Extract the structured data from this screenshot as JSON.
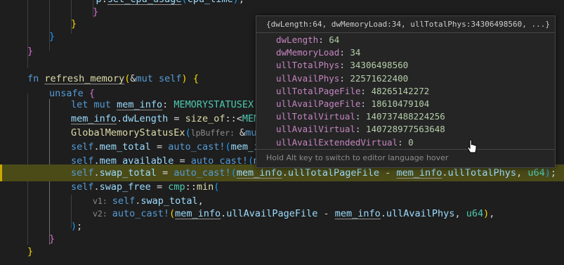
{
  "editor": {
    "lines": [
      {
        "id": "L0",
        "tokens": [
          [
            "p",
            "            "
          ],
          [
            "id",
            "p"
          ],
          [
            "p",
            "."
          ],
          [
            "id",
            "set_cpu_usage"
          ],
          [
            "br3",
            "("
          ],
          [
            "id",
            "cpu_time"
          ],
          [
            "br3",
            ")"
          ],
          [
            "p",
            ";"
          ]
        ]
      },
      {
        "id": "L1",
        "tokens": [
          [
            "br2",
            "}"
          ]
        ]
      },
      {
        "id": "L2",
        "tokens": [
          [
            "br1",
            "}"
          ]
        ]
      },
      {
        "id": "L3",
        "tokens": [
          [
            "br3",
            "}"
          ]
        ]
      },
      {
        "id": "L4",
        "tokens": [
          [
            "br2",
            "}"
          ]
        ]
      },
      {
        "id": "L5",
        "tokens": []
      },
      {
        "id": "L6",
        "tokens": [
          [
            "kw",
            "fn"
          ],
          [
            "p",
            " "
          ],
          [
            "fnc",
            "refresh_memory"
          ],
          [
            "br1",
            "("
          ],
          [
            "p",
            "&"
          ],
          [
            "kw",
            "mut"
          ],
          [
            "p",
            " "
          ],
          [
            "self",
            "self"
          ],
          [
            "br1",
            ")"
          ],
          [
            "p",
            " "
          ],
          [
            "br1",
            "{"
          ]
        ]
      },
      {
        "id": "L7",
        "tokens": [
          [
            "kw",
            "unsafe"
          ],
          [
            "p",
            " "
          ],
          [
            "br2",
            "{"
          ]
        ]
      },
      {
        "id": "L8",
        "tokens": [
          [
            "kw",
            "let"
          ],
          [
            "p",
            " "
          ],
          [
            "kw",
            "mut"
          ],
          [
            "p",
            " "
          ],
          [
            "id",
            "mem_info"
          ],
          [
            "p",
            ": "
          ],
          [
            "ty",
            "MEMORYSTATUSEX"
          ],
          [
            "p",
            " ="
          ]
        ]
      },
      {
        "id": "L9",
        "tokens": [
          [
            "id",
            "mem_info"
          ],
          [
            "p",
            "."
          ],
          [
            "id",
            "dwLength"
          ],
          [
            "p",
            " = "
          ],
          [
            "fnc",
            "size_of"
          ],
          [
            "p",
            "::<"
          ],
          [
            "ty",
            "MEMORY"
          ]
        ]
      },
      {
        "id": "L10",
        "tokens": [
          [
            "fnc",
            "GlobalMemoryStatusEx"
          ],
          [
            "br3",
            "("
          ],
          [
            "hint",
            "lpBuffer: "
          ],
          [
            "p",
            "&"
          ],
          [
            "kw",
            "mut"
          ]
        ]
      },
      {
        "id": "L11",
        "tokens": [
          [
            "self",
            "self"
          ],
          [
            "p",
            "."
          ],
          [
            "id",
            "mem_total"
          ],
          [
            "p",
            " = "
          ],
          [
            "mac",
            "auto_cast!"
          ],
          [
            "br3",
            "("
          ],
          [
            "id",
            "mem_in"
          ]
        ]
      },
      {
        "id": "L12",
        "tokens": [
          [
            "self",
            "self"
          ],
          [
            "p",
            "."
          ],
          [
            "id",
            "mem_available"
          ],
          [
            "p",
            " = "
          ],
          [
            "mac",
            "auto_cast!"
          ],
          [
            "br3",
            "("
          ],
          [
            "id",
            "me"
          ]
        ]
      },
      {
        "id": "L13",
        "tokens": [
          [
            "self",
            "self"
          ],
          [
            "p",
            "."
          ],
          [
            "id",
            "swap_total"
          ],
          [
            "p",
            " = "
          ],
          [
            "mac",
            "auto_cast!"
          ],
          [
            "br3",
            "("
          ],
          [
            "id",
            "mem_info"
          ],
          [
            "p",
            "."
          ],
          [
            "id",
            "ullTotalPageFile"
          ],
          [
            "p",
            " - "
          ],
          [
            "id",
            "mem_info"
          ],
          [
            "p",
            "."
          ],
          [
            "id",
            "ullTotalPhys"
          ],
          [
            "p",
            ", "
          ],
          [
            "ty",
            "u64"
          ],
          [
            "br3",
            ")"
          ],
          [
            "p",
            ";"
          ]
        ]
      },
      {
        "id": "L14",
        "tokens": [
          [
            "self",
            "self"
          ],
          [
            "p",
            "."
          ],
          [
            "id",
            "swap_free"
          ],
          [
            "p",
            " = "
          ],
          [
            "ty",
            "cmp"
          ],
          [
            "p",
            "::"
          ],
          [
            "fnc",
            "min"
          ],
          [
            "br3",
            "("
          ]
        ]
      },
      {
        "id": "L15",
        "tokens": [
          [
            "hint",
            "v1: "
          ],
          [
            "self",
            "self"
          ],
          [
            "p",
            "."
          ],
          [
            "id",
            "swap_total"
          ],
          [
            "p",
            ","
          ]
        ]
      },
      {
        "id": "L16",
        "tokens": [
          [
            "hint",
            "v2: "
          ],
          [
            "mac",
            "auto_cast!"
          ],
          [
            "br1",
            "("
          ],
          [
            "id",
            "mem_info"
          ],
          [
            "p",
            "."
          ],
          [
            "id",
            "ullAvailPageFile"
          ],
          [
            "p",
            " - "
          ],
          [
            "id",
            "mem_info"
          ],
          [
            "p",
            "."
          ],
          [
            "id",
            "ullAvailPhys"
          ],
          [
            "p",
            ", "
          ],
          [
            "ty",
            "u64"
          ],
          [
            "br1",
            ")"
          ],
          [
            "p",
            ","
          ]
        ]
      },
      {
        "id": "L17",
        "tokens": [
          [
            "br3",
            ")"
          ],
          [
            "p",
            ";"
          ]
        ]
      },
      {
        "id": "L18",
        "tokens": [
          [
            "br2",
            "}"
          ]
        ]
      },
      {
        "id": "L19",
        "tokens": [
          [
            "br1",
            "}"
          ]
        ]
      }
    ]
  },
  "hover": {
    "title": "{dwLength:64, dwMemoryLoad:34, ullTotalPhys:34306498560, ...}",
    "fields": [
      {
        "key": "dwLength",
        "value": "64"
      },
      {
        "key": "dwMemoryLoad",
        "value": "34"
      },
      {
        "key": "ullTotalPhys",
        "value": "34306498560"
      },
      {
        "key": "ullAvailPhys",
        "value": "22571622400"
      },
      {
        "key": "ullTotalPageFile",
        "value": "48265142272"
      },
      {
        "key": "ullAvailPageFile",
        "value": "18610479104"
      },
      {
        "key": "ullTotalVirtual",
        "value": "140737488224256"
      },
      {
        "key": "ullAvailVirtual",
        "value": "140728977563648"
      },
      {
        "key": "ullAvailExtendedVirtual",
        "value": "0"
      }
    ],
    "footer": "Hold Alt key to switch to editor language hover"
  },
  "colors": {
    "background": "#1e1e1e",
    "highlight_line": "#4b4b18",
    "hover_background": "#252526"
  }
}
